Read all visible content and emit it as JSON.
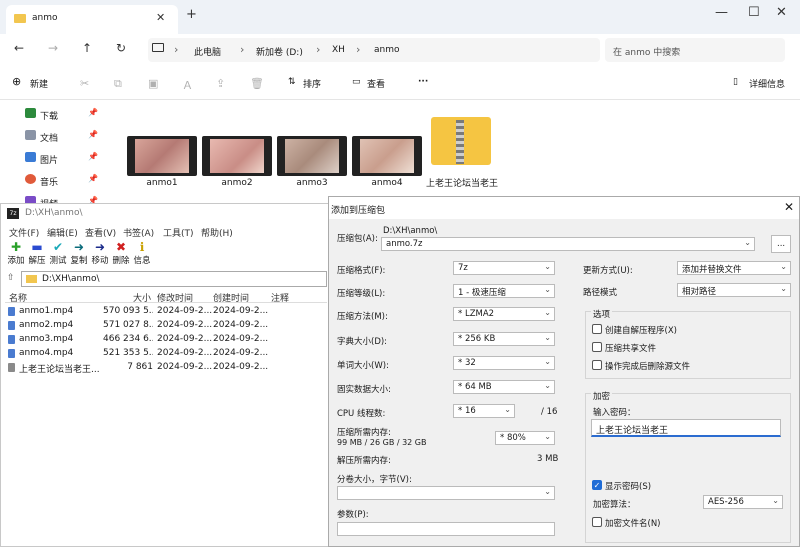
{
  "explorer": {
    "tab_title": "anmo",
    "breadcrumb": [
      "此电脑",
      "新加卷 (D:)",
      "XH",
      "anmo"
    ],
    "search_placeholder": "在 anmo 中搜索",
    "cmd": {
      "new": "新建",
      "sort": "排序",
      "view": "查看",
      "more": "···",
      "details": "详细信息"
    },
    "sidebar": [
      {
        "label": "下载",
        "icon": "download-icon"
      },
      {
        "label": "文档",
        "icon": "document-icon"
      },
      {
        "label": "图片",
        "icon": "pictures-icon"
      },
      {
        "label": "音乐",
        "icon": "music-icon"
      },
      {
        "label": "视频",
        "icon": "video-icon"
      }
    ],
    "files": [
      "anmo1",
      "anmo2",
      "anmo3",
      "anmo4"
    ],
    "zip_label": "上老王论坛当老王"
  },
  "sevenzip": {
    "title": "D:\\XH\\anmo\\",
    "menu": [
      "文件(F)",
      "编辑(E)",
      "查看(V)",
      "书签(A)",
      "工具(T)",
      "帮助(H)"
    ],
    "toolbar": [
      "添加",
      "解压",
      "测试",
      "复制",
      "移动",
      "删除",
      "信息"
    ],
    "address": "D:\\XH\\anmo\\",
    "columns": [
      "名称",
      "大小",
      "修改时间",
      "创建时间",
      "注释"
    ],
    "rows": [
      {
        "name": "anmo1.mp4",
        "size": "570 093 5...",
        "mtime": "2024-09-2...",
        "ctime": "2024-09-2..."
      },
      {
        "name": "anmo2.mp4",
        "size": "571 027 8...",
        "mtime": "2024-09-2...",
        "ctime": "2024-09-2..."
      },
      {
        "name": "anmo3.mp4",
        "size": "466 234 6...",
        "mtime": "2024-09-2...",
        "ctime": "2024-09-2..."
      },
      {
        "name": "anmo4.mp4",
        "size": "521 353 5...",
        "mtime": "2024-09-2...",
        "ctime": "2024-09-2..."
      },
      {
        "name": "上老王论坛当老王...",
        "size": "7 861",
        "mtime": "2024-09-2...",
        "ctime": "2024-09-2..."
      }
    ]
  },
  "dialog": {
    "title": "添加到压缩包",
    "archive_label": "压缩包(A):",
    "archive_path": "D:\\XH\\anmo\\",
    "archive_name": "anmo.7z",
    "browse": "...",
    "format_label": "压缩格式(F):",
    "format": "7z",
    "level_label": "压缩等级(L):",
    "level": "1 - 极速压缩",
    "method_label": "压缩方法(M):",
    "method": "* LZMA2",
    "dict_label": "字典大小(D):",
    "dict": "* 256 KB",
    "word_label": "单词大小(W):",
    "word": "* 32",
    "solid_label": "固实数据大小:",
    "solid": "* 64 MB",
    "cpu_label": "CPU 线程数:",
    "cpu": "* 16",
    "cpu_total": "/ 16",
    "mem_label": "压缩所需内存:",
    "mem_detail": "99 MB / 26 GB / 32 GB",
    "mem_pct": "* 80%",
    "dmem_label": "解压所需内存:",
    "dmem": "3 MB",
    "split_label": "分卷大小，字节(V):",
    "params_label": "参数(P):",
    "update_label": "更新方式(U):",
    "update": "添加并替换文件",
    "pathmode_label": "路径模式",
    "pathmode": "相对路径",
    "options_label": "选项",
    "opt_sfx": "创建自解压程序(X)",
    "opt_shared": "压缩共享文件",
    "opt_delete": "操作完成后删除源文件",
    "enc_label": "加密",
    "pwd_label": "输入密码：",
    "password": "上老王论坛当老王",
    "show_pwd": "显示密码(S)",
    "enc_method_label": "加密算法：",
    "enc_method": "AES-256",
    "enc_names": "加密文件名(N)"
  }
}
